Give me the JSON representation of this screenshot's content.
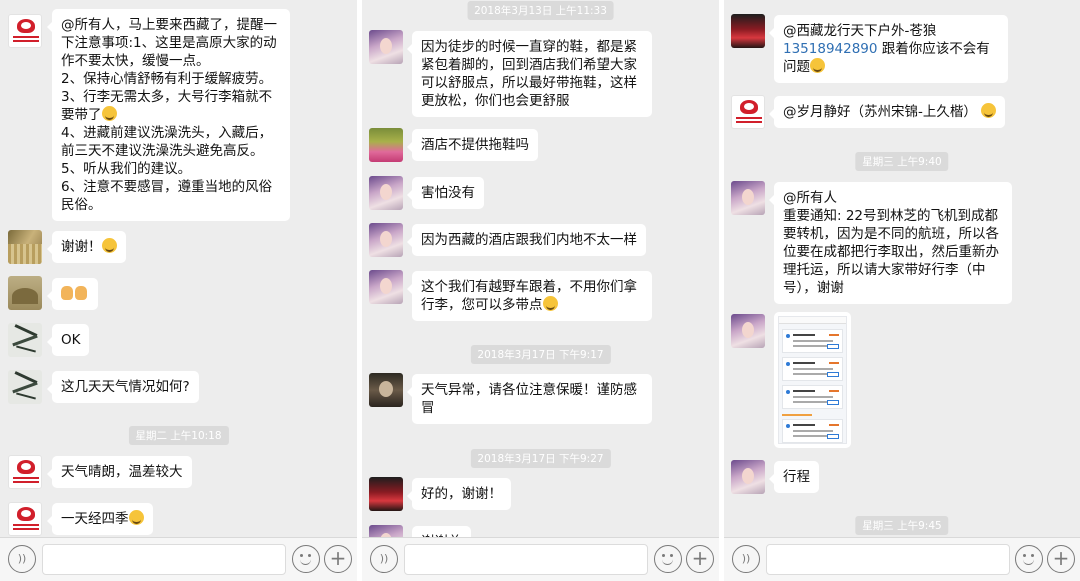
{
  "panel1": {
    "messages": [
      {
        "text": "@所有人，马上要来西藏了，提醒一下注意事项:1、这里是高原大家的动作不要太快，缓慢一点。\n2、保持心情舒畅有利于缓解疲劳。\n3、行李无需太多，大号行李箱就不要带了",
        "text2": "\n4、进藏前建议洗澡洗头，入藏后，前三天不建议洗澡洗头避免高反。\n5、听从我们的建议。\n6、注意不要感冒，遵重当地的风俗民俗。"
      },
      {
        "text": "谢谢！"
      },
      {
        "text": ""
      },
      {
        "text": "OK"
      },
      {
        "text": "这几天天气情况如何?"
      },
      {
        "text": "天气晴朗，温差较大"
      },
      {
        "text": "一天经四季"
      }
    ],
    "timestamps": [
      "星期二 上午10:18"
    ]
  },
  "panel2": {
    "timestamps": [
      "2018年3月13日 上午11:33",
      "2018年3月17日 下午9:17",
      "2018年3月17日 下午9:27"
    ],
    "messages": [
      {
        "text": "因为徒步的时候一直穿的鞋，都是紧紧包着脚的，回到酒店我们希望大家可以舒服点，所以最好带拖鞋，这样更放松，你们也会更舒服"
      },
      {
        "text": "酒店不提供拖鞋吗"
      },
      {
        "text": "害怕没有"
      },
      {
        "text": "因为西藏的酒店跟我们内地不太一样"
      },
      {
        "text": "这个我们有越野车跟着，不用你们拿行李，您可以多带点"
      },
      {
        "text": "天气异常，请各位注意保暖！谨防感冒"
      },
      {
        "text": "好的，谢谢！"
      },
      {
        "text": "谢谢总"
      }
    ]
  },
  "panel3": {
    "timestamps": [
      "星期三 上午9:40",
      "星期三 上午9:45"
    ],
    "messages": [
      {
        "text": "@西藏龙行天下户外-苍狼\n",
        "link": "13518942890",
        "text2": " 跟着你应该不会有问题"
      },
      {
        "text": "@岁月静好（苏州宋锦-上久楷）"
      },
      {
        "text": "@所有人\n重要通知: 22号到林芝的飞机到成都要转机，因为是不同的航班，所以各位要在成都把行李取出，然后重新办理托运，所以请大家带好行李（中号），谢谢"
      },
      {
        "text": "行程"
      }
    ]
  },
  "icons": {
    "voice": "voice-icon",
    "emoji": "emoji-icon",
    "plus": "plus-icon"
  },
  "colors": {
    "chat_bg": "#ededed",
    "bubble": "#ffffff",
    "link": "#2f6fb3",
    "timestamp_bg": "#dadada"
  }
}
